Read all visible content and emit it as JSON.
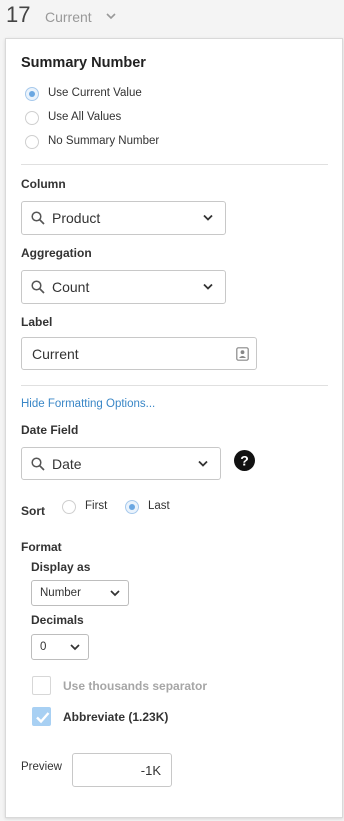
{
  "header": {
    "number": "17",
    "label": "Current"
  },
  "summary": {
    "title": "Summary Number",
    "options": [
      {
        "label": "Use Current Value",
        "selected": true
      },
      {
        "label": "Use All Values",
        "selected": false
      },
      {
        "label": "No Summary Number",
        "selected": false
      }
    ]
  },
  "column": {
    "label": "Column",
    "value": "Product"
  },
  "aggregation": {
    "label": "Aggregation",
    "value": "Count"
  },
  "label_field": {
    "label": "Label",
    "value": "Current"
  },
  "formatting_link": "Hide Formatting Options...",
  "date_field": {
    "label": "Date Field",
    "value": "Date"
  },
  "sort": {
    "label": "Sort",
    "first": "First",
    "last": "Last",
    "selected": "Last"
  },
  "format": {
    "label": "Format",
    "display_as_label": "Display as",
    "display_as_value": "Number",
    "decimals_label": "Decimals",
    "decimals_value": "0",
    "thousands_label": "Use thousands separator",
    "thousands_checked": false,
    "abbreviate_label": "Abbreviate (1.23K)",
    "abbreviate_checked": true
  },
  "preview": {
    "label": "Preview",
    "value": "-1K"
  },
  "colors": {
    "accent": "#6aa7e2",
    "link": "#3a87c7",
    "checkbox_on": "#a8d0f3"
  }
}
